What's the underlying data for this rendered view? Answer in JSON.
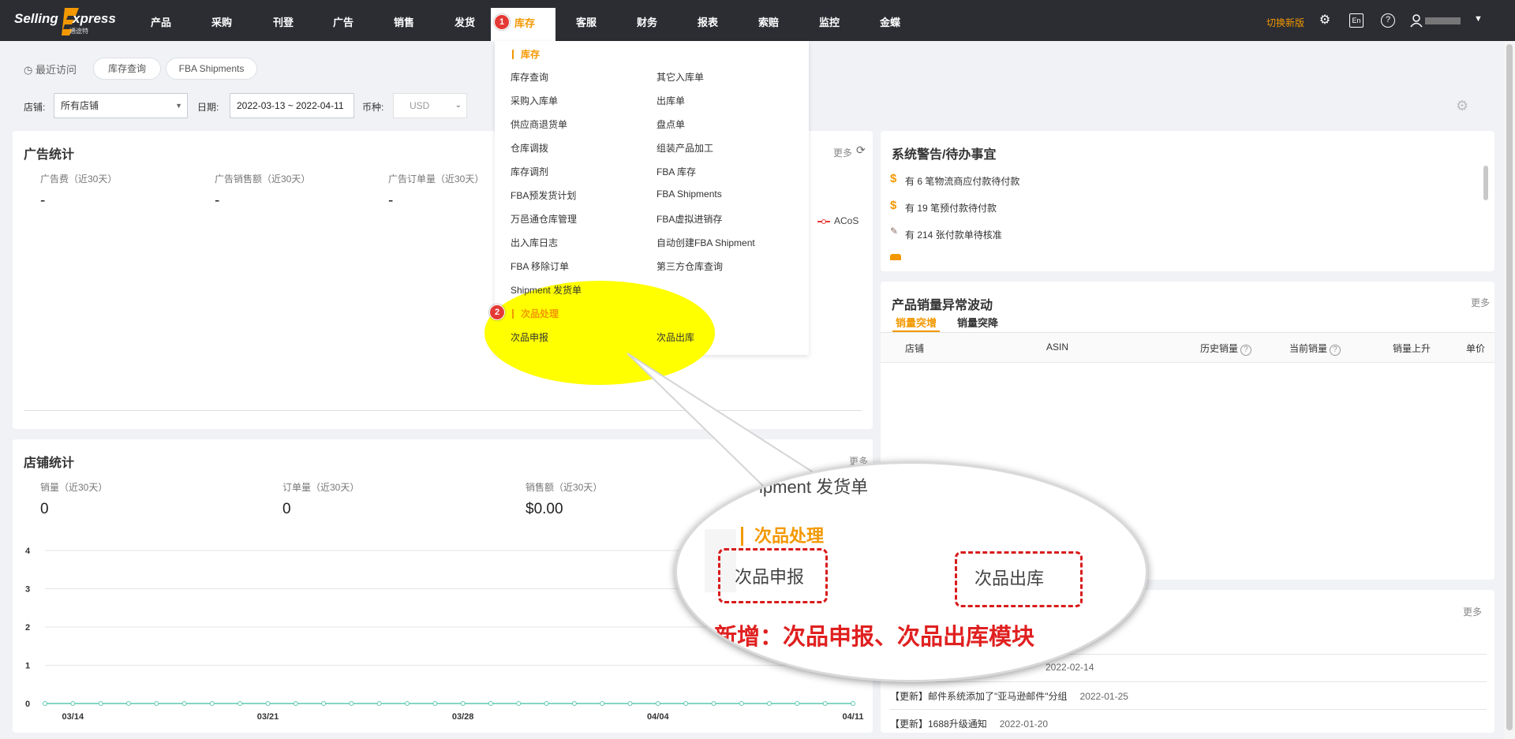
{
  "logo": {
    "part1": "Selling",
    "part2": "xpress",
    "sub": "通途特"
  },
  "nav": {
    "items": [
      {
        "label": "产品"
      },
      {
        "label": "采购"
      },
      {
        "label": "刊登"
      },
      {
        "label": "广告"
      },
      {
        "label": "销售"
      },
      {
        "label": "发货"
      },
      {
        "label": "库存"
      },
      {
        "label": "客服"
      },
      {
        "label": "财务"
      },
      {
        "label": "报表"
      },
      {
        "label": "索赔"
      },
      {
        "label": "监控"
      },
      {
        "label": "金蝶"
      }
    ],
    "switch_version": "切换新版",
    "lang": "En",
    "help": "?",
    "caret": "▼"
  },
  "badges": {
    "one": "1",
    "two": "2"
  },
  "recent": {
    "label": "最近访问",
    "chips": [
      "库存查询",
      "FBA Shipments"
    ]
  },
  "filters": {
    "store_label": "店铺:",
    "store_value": "所有店铺",
    "date_label": "日期:",
    "date_value": "2022-03-13 ~ 2022-04-11",
    "currency_label": "币种:",
    "currency_value": "USD"
  },
  "ad_stats": {
    "title": "广告统计",
    "more": "更多",
    "items": [
      {
        "label": "广告费（近30天）",
        "value": "-"
      },
      {
        "label": "广告销售额（近30天）",
        "value": "-"
      },
      {
        "label": "广告订单量（近30天）",
        "value": "-"
      }
    ],
    "legend": "ACoS"
  },
  "store_stats": {
    "title": "店铺统计",
    "more": "更多",
    "items": [
      {
        "label": "销量（近30天）",
        "value": "0"
      },
      {
        "label": "订单量（近30天）",
        "value": "0"
      },
      {
        "label": "销售额（近30天）",
        "value": "$0.00"
      }
    ]
  },
  "chart_data": {
    "type": "line",
    "x": [
      "03/13",
      "03/14",
      "03/15",
      "03/16",
      "03/17",
      "03/18",
      "03/19",
      "03/20",
      "03/21",
      "03/22",
      "03/23",
      "03/24",
      "03/25",
      "03/26",
      "03/27",
      "03/28",
      "03/29",
      "03/30",
      "03/31",
      "04/01",
      "04/02",
      "04/03",
      "04/04",
      "04/05",
      "04/06",
      "04/07",
      "04/08",
      "04/09",
      "04/10",
      "04/11"
    ],
    "x_tick_labels": [
      "03/14",
      "03/21",
      "03/28",
      "04/04",
      "04/11"
    ],
    "y_tick_labels": [
      "0",
      "1",
      "2",
      "3",
      "4"
    ],
    "ylim": [
      0,
      4
    ],
    "series": [
      {
        "values": [
          0,
          0,
          0,
          0,
          0,
          0,
          0,
          0,
          0,
          0,
          0,
          0,
          0,
          0,
          0,
          0,
          0,
          0,
          0,
          0,
          0,
          0,
          0,
          0,
          0,
          0,
          0,
          0,
          0,
          0
        ],
        "color": "#5cc8b0"
      }
    ],
    "grid": true
  },
  "warnings": {
    "title": "系统警告/待办事宜",
    "items": [
      "有 6 笔物流商应付款待付款",
      "有 19 笔预付款待付款",
      "有 214 张付款单待核准"
    ]
  },
  "anomaly": {
    "title": "产品销量异常波动",
    "more": "更多",
    "tabs": [
      "销量突增",
      "销量突降"
    ],
    "columns": [
      "店铺",
      "ASIN",
      "历史销量",
      "当前销量",
      "销量上升",
      "单价"
    ]
  },
  "news": {
    "more": "更多",
    "items": [
      {
        "text": "【更新】邮件系统添加了\"亚马逊邮件\"分组",
        "date": "2022-01-25"
      },
      {
        "text": "【更新】1688升级通知",
        "date": "2022-01-20"
      }
    ],
    "partial_date": "2022-02-14"
  },
  "dropdown": {
    "section1": "库存",
    "left": [
      "库存查询",
      "采购入库单",
      "供应商退货单",
      "仓库调拨",
      "库存调剂",
      "FBA预发货计划",
      "万邑通仓库管理",
      "出入库日志",
      "FBA 移除订单",
      "Shipment 发货单"
    ],
    "right": [
      "其它入库单",
      "出库单",
      "盘点单",
      "组装产品加工",
      "FBA 库存",
      "FBA Shipments",
      "FBA虚拟进销存",
      "自动创建FBA Shipment",
      "第三方仓库查询"
    ],
    "section2": "次品处理",
    "sec2_items": [
      "次品申报",
      "次品出库"
    ]
  },
  "callout": {
    "shipment_text": "ipment 发货单",
    "section": "次品处理",
    "item1": "次品申报",
    "item2": "次品出库",
    "caption": "新增：次品申报、次品出库模块"
  }
}
